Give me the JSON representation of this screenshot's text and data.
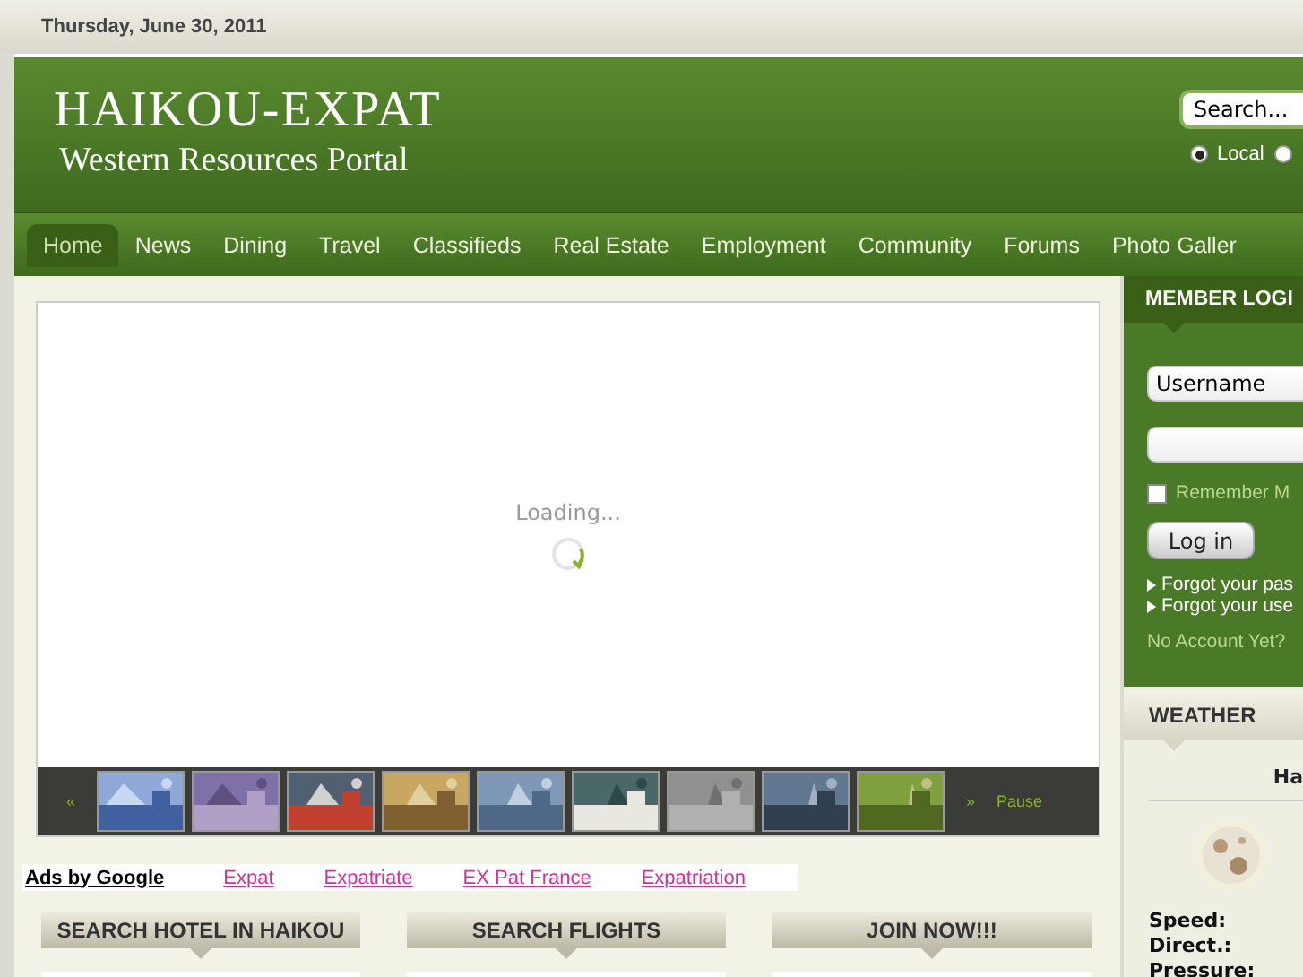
{
  "date": "Thursday, June 30, 2011",
  "header": {
    "title": "HAIKOU-EXPAT",
    "subtitle": "Western Resources Portal",
    "search": {
      "value": "Search..."
    },
    "scope": [
      {
        "label": "Local",
        "selected": true
      },
      {
        "selected": false
      }
    ]
  },
  "nav": [
    {
      "label": "Home",
      "selected": true
    },
    {
      "label": "News",
      "selected": false
    },
    {
      "label": "Dining",
      "selected": false
    },
    {
      "label": "Travel",
      "selected": false
    },
    {
      "label": "Classifieds",
      "selected": false
    },
    {
      "label": "Real Estate",
      "selected": false
    },
    {
      "label": "Employment",
      "selected": false
    },
    {
      "label": "Community",
      "selected": false
    },
    {
      "label": "Forums",
      "selected": false
    },
    {
      "label": "Photo Galler",
      "selected": false
    }
  ],
  "slideshow": {
    "status": "Loading...",
    "prev": "«",
    "next": "»",
    "pause": "Pause"
  },
  "ads": {
    "label": "Ads by Google",
    "links": [
      "Expat",
      "Expatriate",
      "EX Pat France",
      "Expatriation"
    ]
  },
  "modules": [
    "SEARCH HOTEL IN HAIKOU",
    "SEARCH FLIGHTS",
    "JOIN NOW!!!"
  ],
  "login": {
    "title": "MEMBER LOGI",
    "username": "Username",
    "remember": {
      "label": "Remember M",
      "checked": false
    },
    "button": "Log in",
    "links": [
      "Forgot your pas",
      "Forgot your use"
    ],
    "register": "No Account Yet?"
  },
  "weather": {
    "title": "WEATHER",
    "city": "Ha",
    "labels": [
      "Speed:",
      "Direct.:",
      "Pressure:"
    ]
  }
}
